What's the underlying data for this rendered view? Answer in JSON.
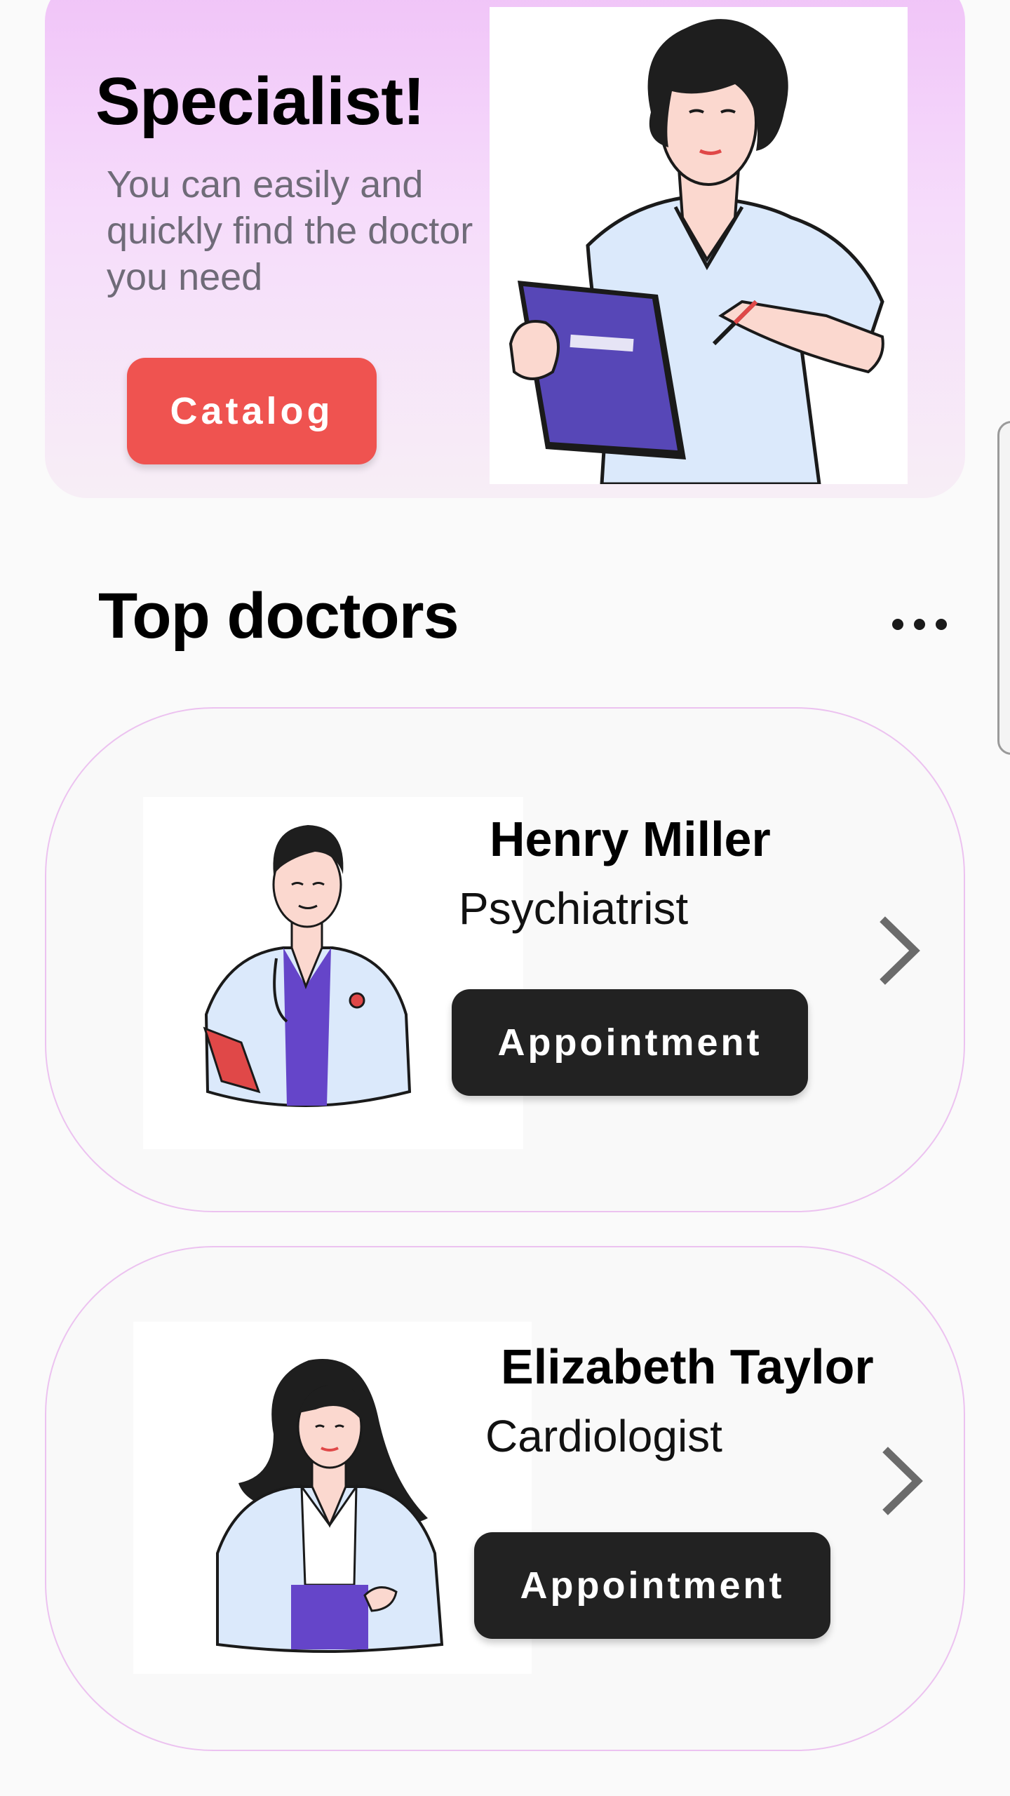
{
  "banner": {
    "title": "Specialist!",
    "subtitle": "You can easily and quickly find the doctor you need",
    "button_label": "Catalog",
    "illustration_icon": "nurse-with-clipboard-illustration"
  },
  "top_doctors": {
    "title": "Top doctors",
    "more_icon": "more-horizontal-icon",
    "items": [
      {
        "name": "Henry Miller",
        "specialty": "Psychiatrist",
        "button_label": "Appointment",
        "avatar_icon": "male-doctor-illustration"
      },
      {
        "name": "Elizabeth Taylor",
        "specialty": "Cardiologist",
        "button_label": "Appointment",
        "avatar_icon": "female-doctor-illustration"
      }
    ]
  },
  "colors": {
    "accent": "#ef5350",
    "banner_top": "#f0c3f8",
    "card_border": "#ecc2f0",
    "dark_button": "#222222",
    "scrub_purple": "#6545c9"
  }
}
